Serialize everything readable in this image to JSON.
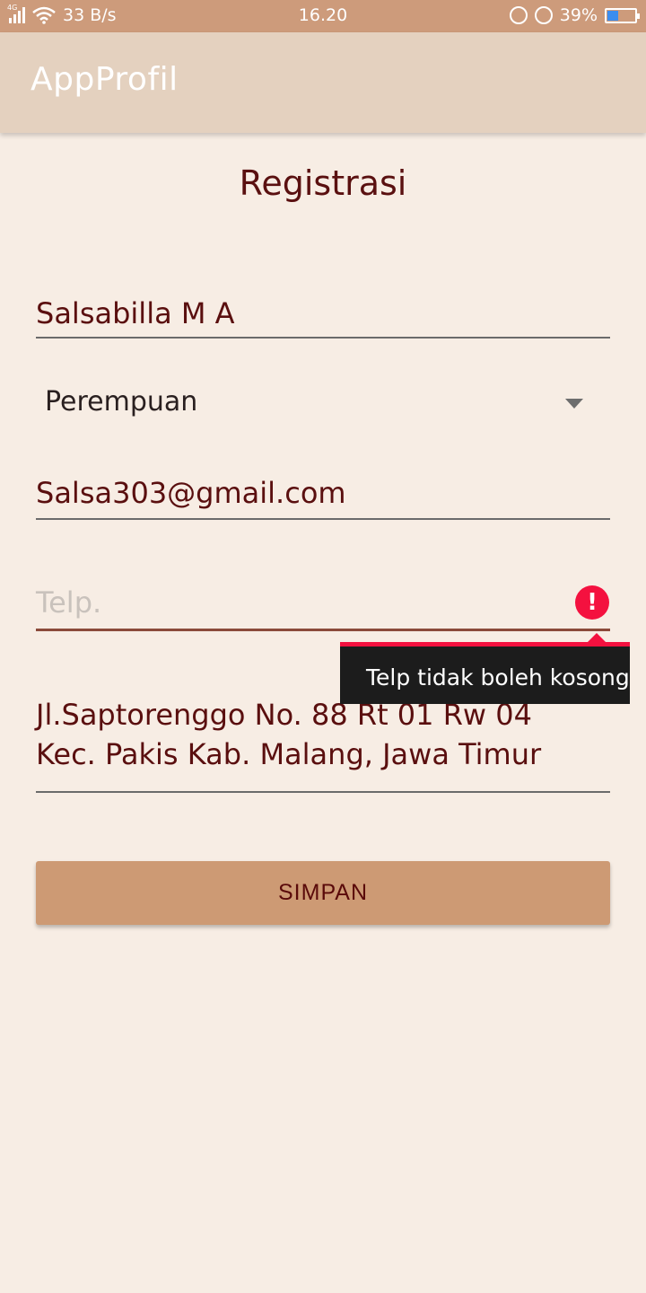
{
  "status_bar": {
    "network": "4G",
    "speed": "33 B/s",
    "time": "16.20",
    "battery_percent": "39%",
    "battery_level": 0.39
  },
  "app_bar": {
    "title": "AppProfil"
  },
  "page": {
    "title": "Registrasi"
  },
  "form": {
    "name": {
      "value": "Salsabilla M A"
    },
    "gender": {
      "selected": "Perempuan"
    },
    "email": {
      "value": "Salsa303@gmail.com"
    },
    "phone": {
      "value": "",
      "placeholder": "Telp.",
      "error": "Telp tidak boleh kosong"
    },
    "address": {
      "value": "Jl.Saptorenggo No. 88 Rt 01 Rw 04 Kec. Pakis Kab. Malang, Jawa Timur"
    },
    "save_label": "SIMPAN"
  },
  "colors": {
    "status_bar": "#cd9b7b",
    "app_bar": "#e4d1bf",
    "background": "#f7ede4",
    "text_primary": "#5a0f0f",
    "error": "#f4113f",
    "button": "#cd9a74"
  },
  "icons": {
    "signal": "signal-icon",
    "wifi": "wifi-icon",
    "rotation_lock": "rotation-lock-icon",
    "alarm": "alarm-icon",
    "battery": "battery-icon",
    "dropdown": "dropdown-caret-icon",
    "error": "error-icon"
  }
}
